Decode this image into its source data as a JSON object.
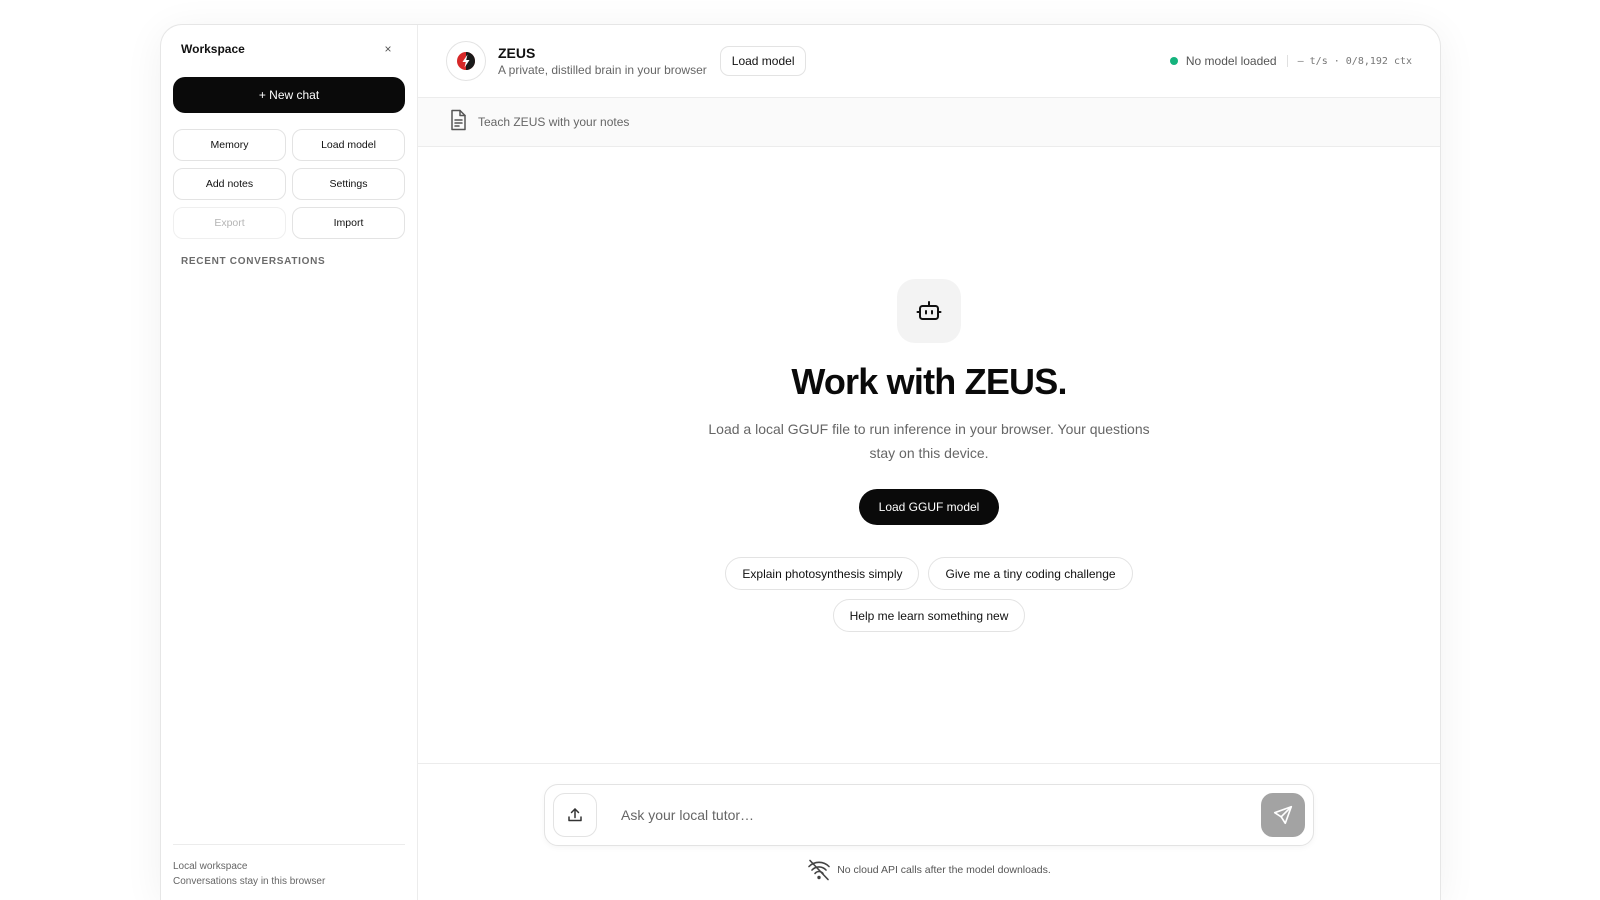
{
  "sidebar": {
    "title": "Workspace",
    "close_label": "×",
    "new_chat_label": "+ New chat",
    "buttons": [
      {
        "label": "Memory",
        "disabled": false
      },
      {
        "label": "Load model",
        "disabled": false
      },
      {
        "label": "Add notes",
        "disabled": false
      },
      {
        "label": "Settings",
        "disabled": false
      },
      {
        "label": "Export",
        "disabled": true
      },
      {
        "label": "Import",
        "disabled": false
      }
    ],
    "section_label": "RECENT CONVERSATIONS",
    "footer_line1": "Local workspace",
    "footer_line2": "Conversations stay in this browser"
  },
  "header": {
    "app_name": "ZEUS",
    "subtitle": "A private, distilled brain in your browser",
    "load_model_label": "Load model",
    "status_text": "No model loaded",
    "metrics_text": "— t/s · 0/8,192 ctx",
    "status_color": "#14b37d",
    "logo_color": "#d62828"
  },
  "notes_bar": {
    "text": "Teach ZEUS with your notes"
  },
  "hero": {
    "title": "Work with ZEUS.",
    "description": "Load a local GGUF file to run inference in your browser. Your questions stay on this device.",
    "button_label": "Load GGUF model",
    "suggestions": [
      "Explain photosynthesis simply",
      "Give me a tiny coding challenge",
      "Help me learn something new"
    ]
  },
  "composer": {
    "placeholder": "Ask your local tutor…",
    "footnote": "No cloud API calls after the model downloads."
  }
}
